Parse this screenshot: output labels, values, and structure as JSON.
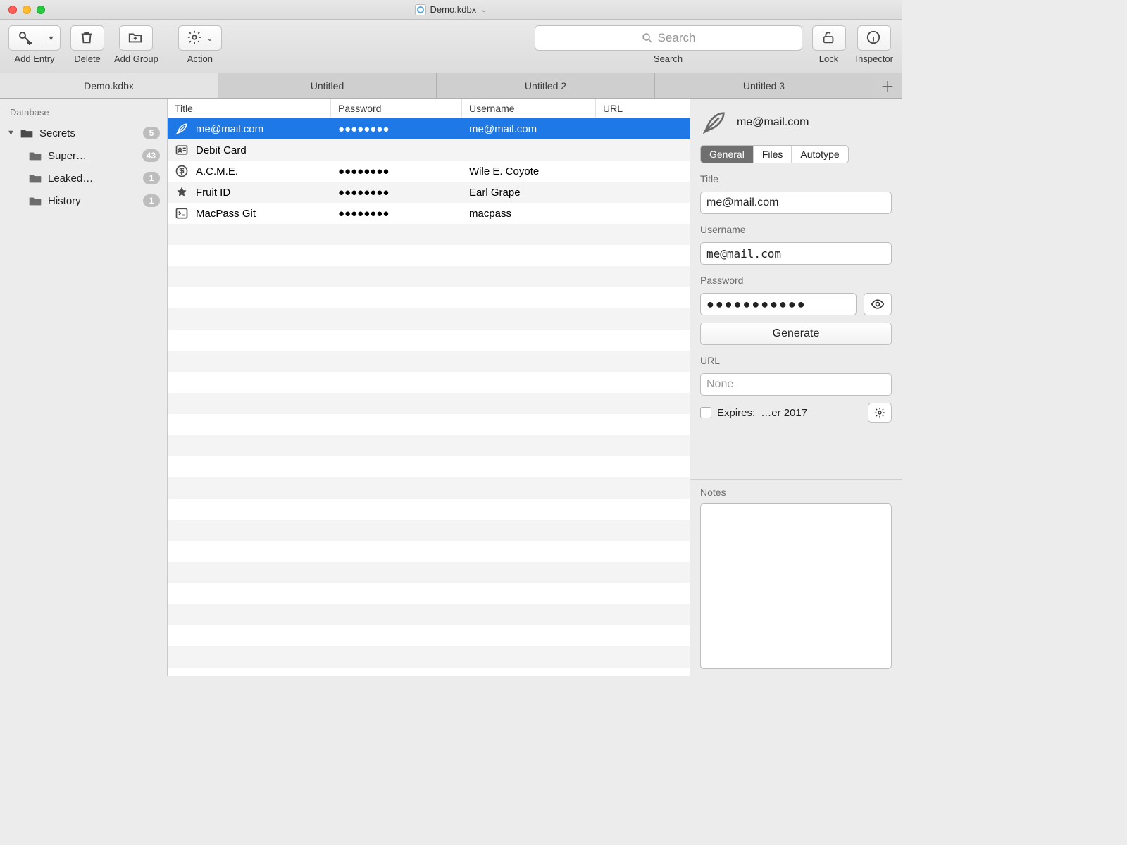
{
  "window": {
    "title": "Demo.kdbx"
  },
  "toolbar": {
    "add_entry": "Add Entry",
    "delete": "Delete",
    "add_group": "Add Group",
    "action": "Action",
    "search_placeholder": "Search",
    "search_label": "Search",
    "lock": "Lock",
    "inspector": "Inspector"
  },
  "tabs": [
    {
      "label": "Demo.kdbx",
      "active": true
    },
    {
      "label": "Untitled",
      "active": false
    },
    {
      "label": "Untitled 2",
      "active": false
    },
    {
      "label": "Untitled 3",
      "active": false
    }
  ],
  "sidebar": {
    "header": "Database",
    "root": {
      "name": "Secrets",
      "count": "5"
    },
    "children": [
      {
        "name": "Super…",
        "count": "43"
      },
      {
        "name": "Leaked…",
        "count": "1"
      },
      {
        "name": "History",
        "count": "1"
      }
    ]
  },
  "columns": {
    "title": "Title",
    "password": "Password",
    "username": "Username",
    "url": "URL"
  },
  "entries": [
    {
      "icon": "feather",
      "title": "me@mail.com",
      "password": "●●●●●●●●",
      "username": "me@mail.com",
      "selected": true
    },
    {
      "icon": "idcard",
      "title": "Debit Card",
      "password": "",
      "username": ""
    },
    {
      "icon": "dollar",
      "title": "A.C.M.E.",
      "password": "●●●●●●●●",
      "username": "Wile E. Coyote"
    },
    {
      "icon": "star",
      "title": "Fruit ID",
      "password": "●●●●●●●●",
      "username": "Earl Grape"
    },
    {
      "icon": "terminal",
      "title": "MacPass Git",
      "password": "●●●●●●●●",
      "username": "macpass"
    }
  ],
  "inspector": {
    "title": "me@mail.com",
    "tabs": {
      "general": "General",
      "files": "Files",
      "autotype": "Autotype"
    },
    "labels": {
      "title": "Title",
      "username": "Username",
      "password": "Password",
      "url": "URL",
      "notes": "Notes"
    },
    "values": {
      "title": "me@mail.com",
      "username": "me@mail.com",
      "password": "●●●●●●●●●●●",
      "url": ""
    },
    "url_placeholder": "None",
    "generate": "Generate",
    "expires_label": "Expires:",
    "expires_value": "…er 2017"
  }
}
